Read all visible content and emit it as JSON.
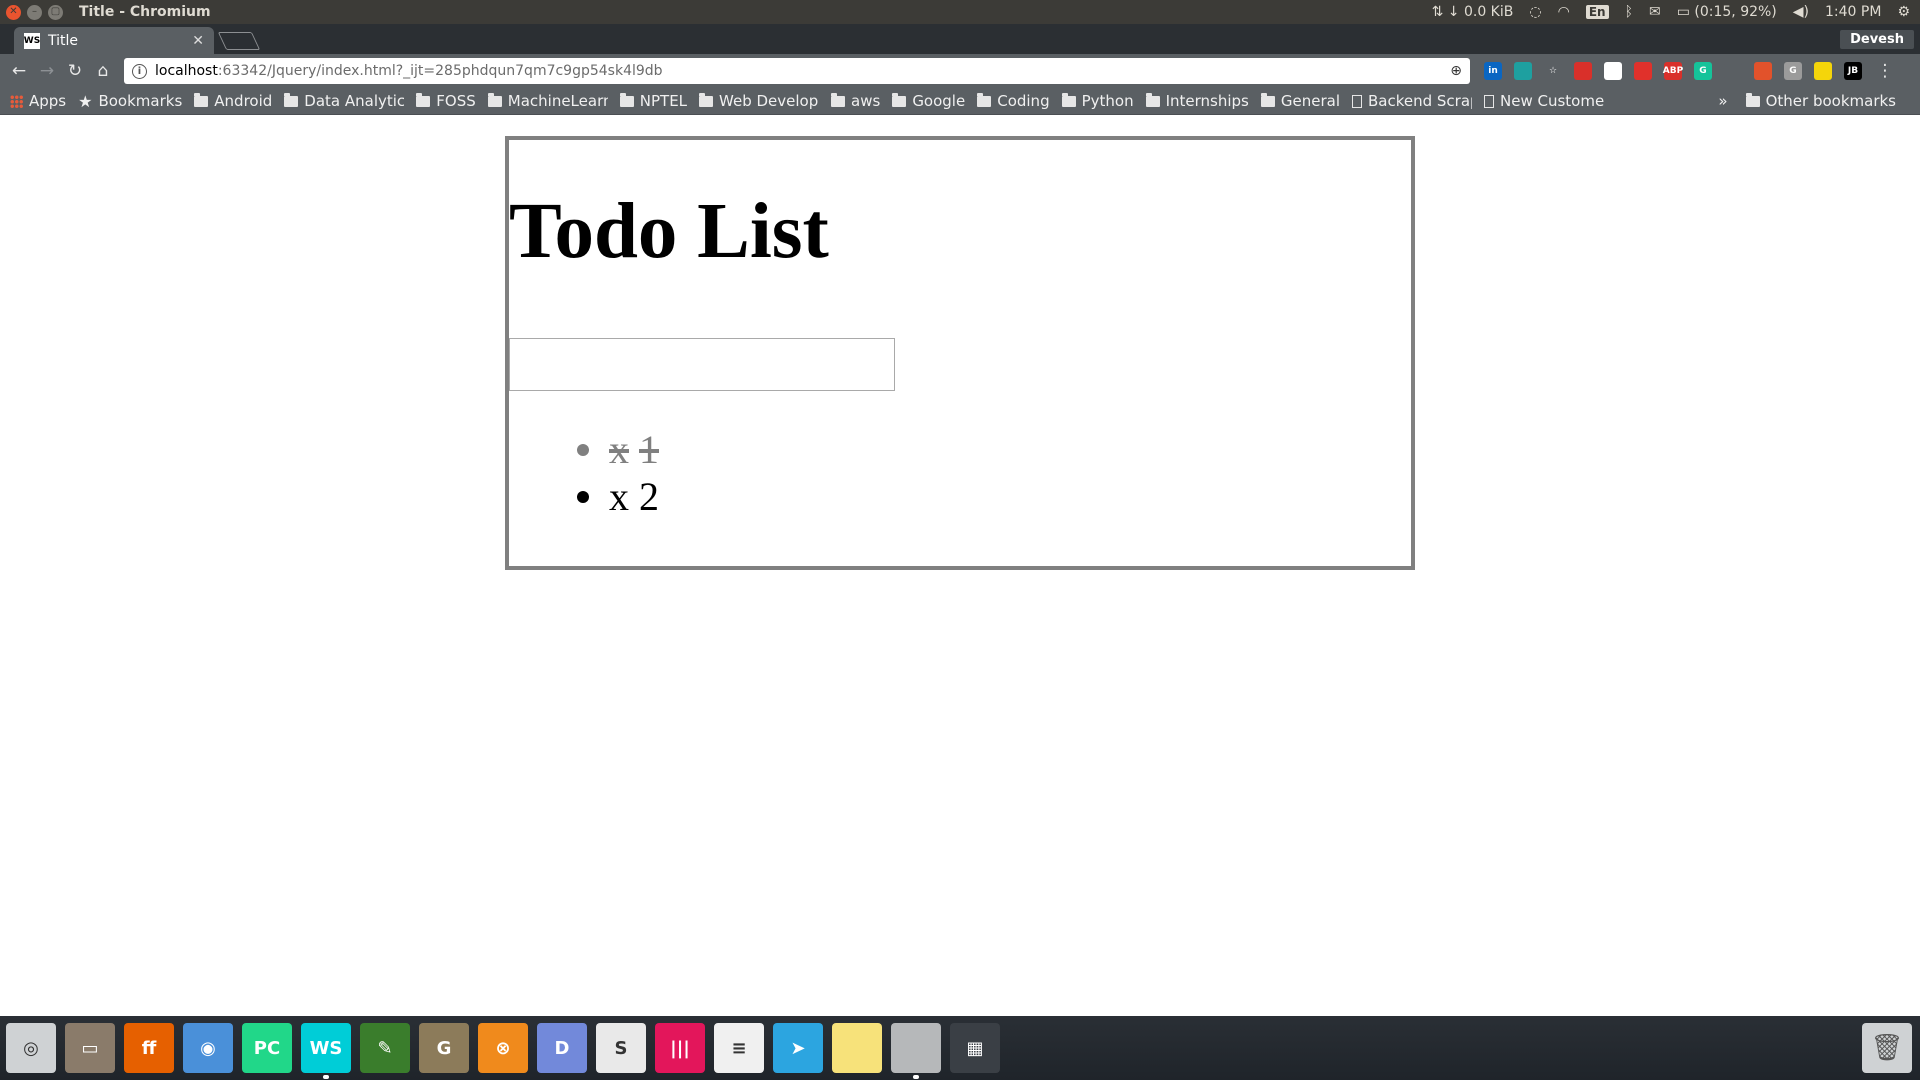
{
  "top_panel": {
    "window_title": "Title - Chromium",
    "net_speed": "⇅ ↓ 0.0 KiB",
    "keyboard_layout": "En",
    "battery": "(0:15, 92%)",
    "clock": "1:40 PM"
  },
  "browser": {
    "tab_title": "Title",
    "tab_favicon_text": "WS",
    "profile_name": "Devesh",
    "url_host": "localhost",
    "url_path": ":63342/Jquery/index.html?_ijt=285phdqun7qm7c9gp54sk4l9db"
  },
  "bookmarks": {
    "items": [
      {
        "label": "Apps",
        "kind": "apps"
      },
      {
        "label": "Bookmarks",
        "kind": "star"
      },
      {
        "label": "Android",
        "kind": "folder"
      },
      {
        "label": "Data Analytics",
        "kind": "folder"
      },
      {
        "label": "FOSS",
        "kind": "folder"
      },
      {
        "label": "MachineLearnin",
        "kind": "folder"
      },
      {
        "label": "NPTEL",
        "kind": "folder"
      },
      {
        "label": "Web Developme",
        "kind": "folder"
      },
      {
        "label": "aws",
        "kind": "folder"
      },
      {
        "label": "Google",
        "kind": "folder"
      },
      {
        "label": "Coding",
        "kind": "folder"
      },
      {
        "label": "Python",
        "kind": "folder"
      },
      {
        "label": "Internships",
        "kind": "folder"
      },
      {
        "label": "General",
        "kind": "folder"
      },
      {
        "label": "Backend Scrapin",
        "kind": "page"
      },
      {
        "label": "New Customer l",
        "kind": "page"
      }
    ],
    "overflow": "»",
    "other": "Other bookmarks"
  },
  "todo": {
    "title": "Todo List",
    "input_value": "",
    "items": [
      {
        "x": "x",
        "text": "1",
        "done": true
      },
      {
        "x": "x",
        "text": "2",
        "done": false
      }
    ]
  },
  "extensions": [
    {
      "name": "linkedin-icon",
      "color": "#0a66c2",
      "text": "in"
    },
    {
      "name": "grammarly-style-icon",
      "color": "#1ea0a0",
      "text": ""
    },
    {
      "name": "bookmark-star-icon",
      "color": "#5a5f63",
      "text": "☆"
    },
    {
      "name": "pdf-icon",
      "color": "#d9302a",
      "text": ""
    },
    {
      "name": "speed-icon",
      "color": "#ffffff",
      "text": ""
    },
    {
      "name": "video-icon",
      "color": "#e0312b",
      "text": ""
    },
    {
      "name": "adblock-icon",
      "color": "#d9302a",
      "text": "ABP"
    },
    {
      "name": "grammarly-icon",
      "color": "#15c39a",
      "text": "G"
    },
    {
      "name": "search-ext-icon",
      "color": "#5a5f63",
      "text": ""
    },
    {
      "name": "shield-ext-icon",
      "color": "#e2522b",
      "text": ""
    },
    {
      "name": "g-ext-icon",
      "color": "#9b9b9b",
      "text": "G"
    },
    {
      "name": "yellow-dot-icon",
      "color": "#f5d50a",
      "text": ""
    },
    {
      "name": "jetbrains-icon",
      "color": "#000000",
      "text": "JB"
    }
  ],
  "dock": [
    {
      "name": "ubuntu-launcher-icon",
      "color": "#cfd2d4",
      "text": "◎"
    },
    {
      "name": "files-icon",
      "color": "#8a7b6a",
      "text": "▭"
    },
    {
      "name": "firefox-icon",
      "color": "#e66000",
      "text": "ff"
    },
    {
      "name": "chromium-icon",
      "color": "#4a90d9",
      "text": "◉"
    },
    {
      "name": "pycharm-icon",
      "color": "#21d789",
      "text": "PC"
    },
    {
      "name": "webstorm-icon",
      "color": "#00cdd7",
      "text": "WS"
    },
    {
      "name": "pen-icon",
      "color": "#3a7d2c",
      "text": "✎"
    },
    {
      "name": "gimp-icon",
      "color": "#8c7b5a",
      "text": "G"
    },
    {
      "name": "crossover-icon",
      "color": "#f08a1c",
      "text": "⊗"
    },
    {
      "name": "discord-icon",
      "color": "#7289da",
      "text": "D"
    },
    {
      "name": "slack-icon",
      "color": "#e9e9e9",
      "text": "S"
    },
    {
      "name": "gitkraken-icon",
      "color": "#e3165b",
      "text": "|||"
    },
    {
      "name": "text-editor-icon",
      "color": "#f0f0f0",
      "text": "≡"
    },
    {
      "name": "telegram-icon",
      "color": "#2ca5e0",
      "text": "➤"
    },
    {
      "name": "sticky-notes-icon",
      "color": "#f7e27a",
      "text": ""
    },
    {
      "name": "blank-app-icon",
      "color": "#b6b8ba",
      "text": ""
    },
    {
      "name": "workspace-switcher-icon",
      "color": "#3a3f45",
      "text": "▦"
    }
  ]
}
